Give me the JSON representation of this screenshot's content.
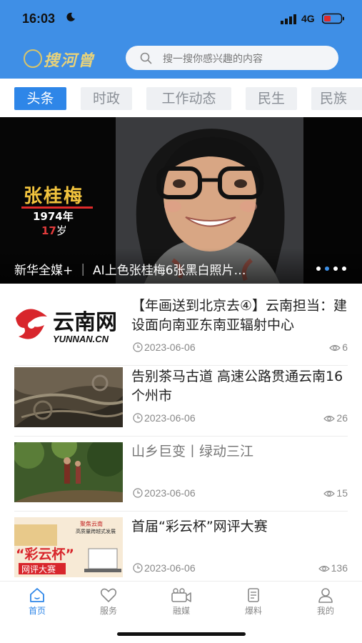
{
  "status_bar": {
    "time": "16:03",
    "network": "4G"
  },
  "header": {
    "logo_text": "搜河曾",
    "search_placeholder": "搜一搜你感兴趣的内容"
  },
  "tabs": [
    {
      "label": "头条",
      "active": true
    },
    {
      "label": "时政",
      "active": false
    },
    {
      "label": "工作动态",
      "active": false
    },
    {
      "label": "民生",
      "active": false
    },
    {
      "label": "民族",
      "active": false
    }
  ],
  "banner": {
    "name": "张桂梅",
    "year": "1974年",
    "age_num": "17",
    "age_unit": "岁",
    "caption": "新华全媒+ ｜ AI上色张桂梅6张黑白照片…",
    "active_dot": 1,
    "dot_count": 4
  },
  "news": [
    {
      "title": "【年画送到北京去④】云南担当：建设面向南亚东南亚辐射中心",
      "date": "2023-06-06",
      "views": "6",
      "gray": false
    },
    {
      "title": "告别茶马古道 高速公路贯通云南16个州市",
      "date": "2023-06-06",
      "views": "26",
      "gray": false
    },
    {
      "title": "山乡巨变丨绿动三江",
      "date": "2023-06-06",
      "views": "15",
      "gray": true
    },
    {
      "title": "首届“彩云杯”网评大赛",
      "date": "2023-06-06",
      "views": "136",
      "gray": false
    }
  ],
  "thumb_text": {
    "yunnan_cn": "云南网",
    "yunnan_en": "YUNNAN.CN",
    "contest_top1": "聚焦云南",
    "contest_top2": "高质量跨越式发展",
    "contest_big": "“彩云杯”",
    "contest_sub": "网评大赛"
  },
  "bottom_nav": [
    {
      "label": "首页",
      "icon": "home-icon",
      "active": true
    },
    {
      "label": "服务",
      "icon": "heart-icon",
      "active": false
    },
    {
      "label": "融媒",
      "icon": "camera-icon",
      "active": false
    },
    {
      "label": "爆料",
      "icon": "document-icon",
      "active": false
    },
    {
      "label": "我的",
      "icon": "user-icon",
      "active": false
    }
  ],
  "colors": {
    "brand_blue": "#3f8fe6",
    "tab_active": "#2e86e8",
    "gold": "#f1c33e",
    "accent_red": "#e02b2b"
  }
}
